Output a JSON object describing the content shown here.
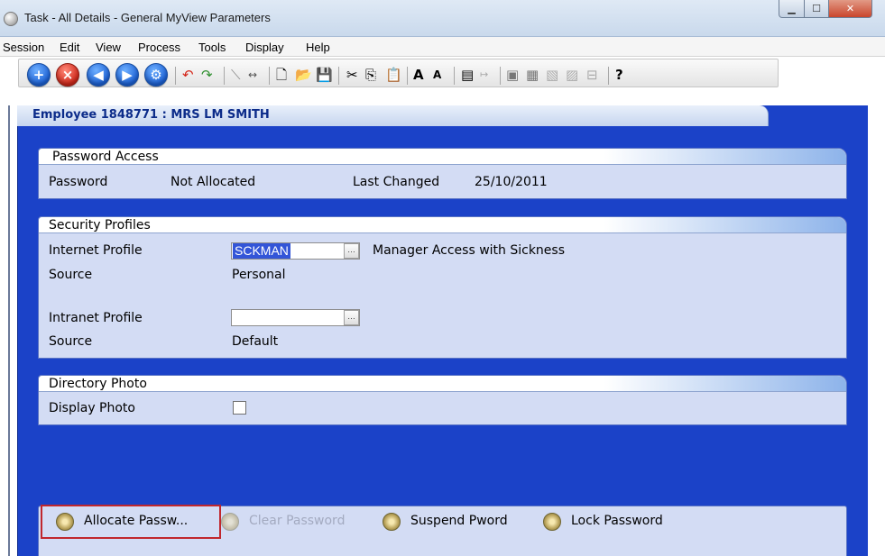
{
  "window": {
    "title": "Task - All Details - General MyView Parameters"
  },
  "menu": [
    "Session",
    "Edit",
    "View",
    "Process",
    "Tools",
    "Display",
    "Help"
  ],
  "toolbar": {
    "help_icon": "?"
  },
  "employee": {
    "header": "Employee  1848771 : MRS LM SMITH"
  },
  "password_access": {
    "title": "Password Access",
    "password_label": "Password",
    "password_value": "Not Allocated",
    "last_changed_label": "Last Changed",
    "last_changed_value": "25/10/2011"
  },
  "security_profiles": {
    "title": "Security Profiles",
    "internet_label": "Internet Profile",
    "internet_value": "SCKMAN",
    "internet_desc": "Manager Access with Sickness",
    "source_label": "Source",
    "internet_source": "Personal",
    "intranet_label": "Intranet Profile",
    "intranet_value": "",
    "intranet_source": "Default"
  },
  "directory_photo": {
    "title": "Directory Photo",
    "display_label": "Display Photo",
    "checked": false
  },
  "actions": {
    "allocate": "Allocate Passw...",
    "clear": "Clear Password",
    "suspend": "Suspend Pword",
    "lock": "Lock Password"
  }
}
